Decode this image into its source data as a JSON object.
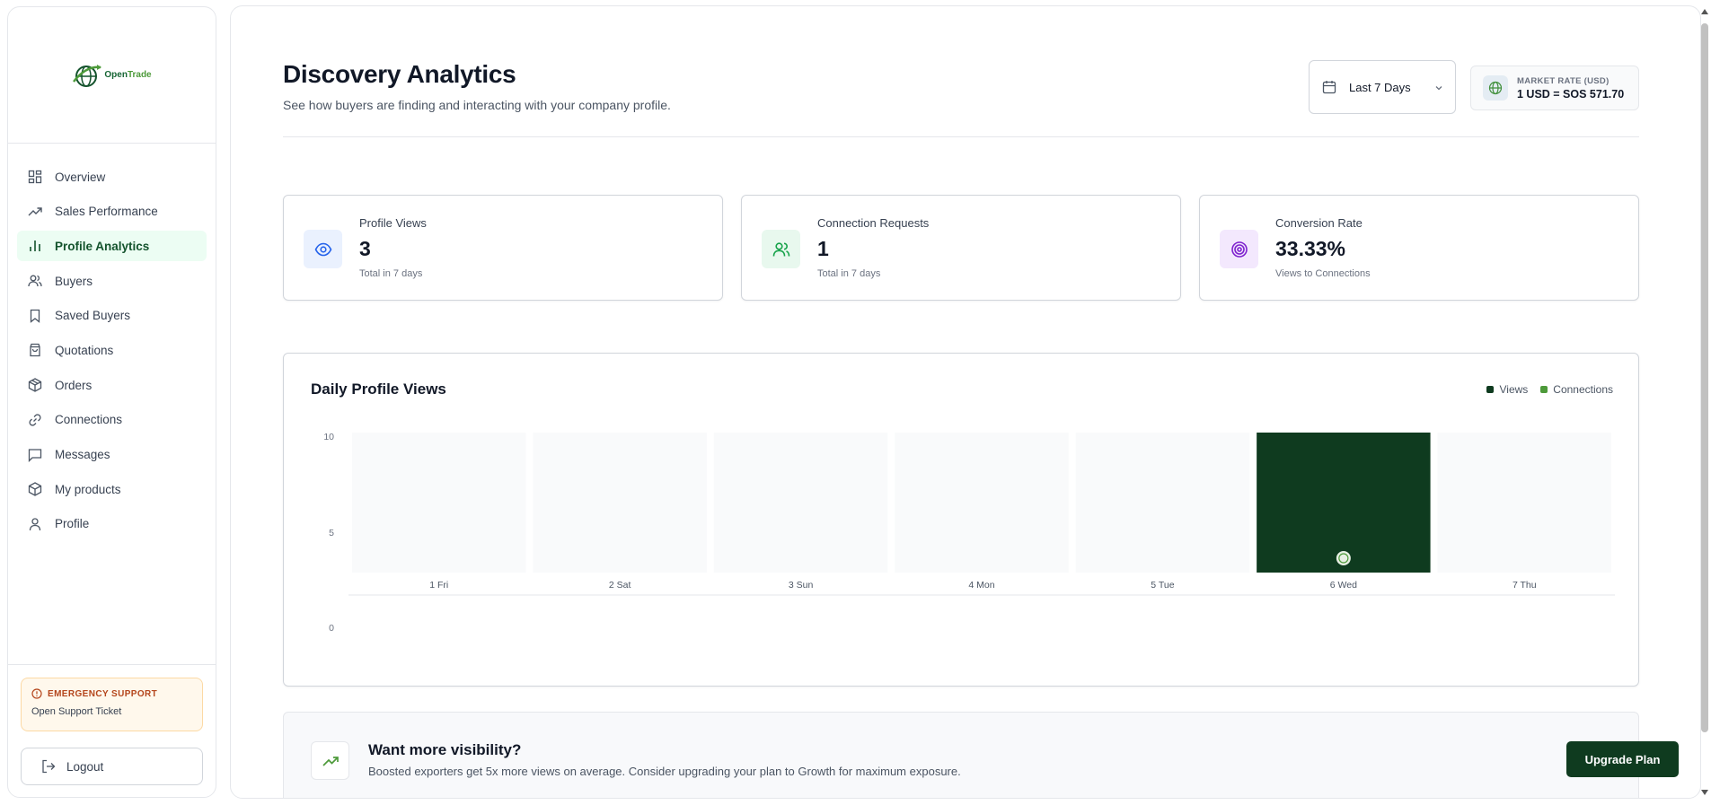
{
  "brand": {
    "name_prefix": "Open",
    "name_suffix": "Trade"
  },
  "sidebar": {
    "items": [
      {
        "label": "Overview",
        "icon": "layout-grid-icon"
      },
      {
        "label": "Sales Performance",
        "icon": "trending-up-icon"
      },
      {
        "label": "Profile Analytics",
        "icon": "bar-chart-icon",
        "active": true
      },
      {
        "label": "Buyers",
        "icon": "users-icon"
      },
      {
        "label": "Saved Buyers",
        "icon": "bookmark-icon"
      },
      {
        "label": "Quotations",
        "icon": "shopping-bag-icon"
      },
      {
        "label": "Orders",
        "icon": "package-icon"
      },
      {
        "label": "Connections",
        "icon": "link-icon"
      },
      {
        "label": "Messages",
        "icon": "message-square-icon"
      },
      {
        "label": "My products",
        "icon": "box-icon"
      },
      {
        "label": "Profile",
        "icon": "user-icon"
      }
    ],
    "emergency_title": "EMERGENCY SUPPORT",
    "emergency_link": "Open Support Ticket",
    "logout_label": "Logout"
  },
  "header": {
    "title": "Discovery Analytics",
    "subtitle": "See how buyers are finding and interacting with your company profile.",
    "date_range": "Last 7 Days",
    "market_label": "MARKET RATE (USD)",
    "market_value": "1 USD = SOS 571.70"
  },
  "stats": [
    {
      "title": "Profile Views",
      "value": "3",
      "sub": "Total in 7 days",
      "icon": "eye-icon",
      "color": "#2563eb",
      "bg": "#eaf1fe"
    },
    {
      "title": "Connection Requests",
      "value": "1",
      "sub": "Total in 7 days",
      "icon": "users-icon",
      "color": "#16a34a",
      "bg": "#e8f8ee"
    },
    {
      "title": "Conversion Rate",
      "value": "33.33%",
      "sub": "Views to Connections",
      "icon": "target-icon",
      "color": "#7e22ce",
      "bg": "#f3e8fd"
    }
  ],
  "chart_title": "Daily Profile Views",
  "chart_data": {
    "type": "bar",
    "categories": [
      "1 Fri",
      "2 Sat",
      "3 Sun",
      "4 Mon",
      "5 Tue",
      "6 Wed",
      "7 Thu"
    ],
    "series": [
      {
        "name": "Views",
        "values": [
          0,
          0,
          0,
          0,
          0,
          3,
          0
        ],
        "color": "#0f3b1f"
      },
      {
        "name": "Connections",
        "values": [
          0,
          0,
          0,
          0,
          0,
          1,
          0
        ],
        "color": "#4d9a3a"
      }
    ],
    "yticks": [
      "10",
      "5",
      "0"
    ],
    "ylim": [
      0,
      10
    ],
    "legend": "top-right",
    "highlight_category": "6 Wed"
  },
  "promo": {
    "title": "Want more visibility?",
    "description": "Boosted exporters get 5x more views on average. Consider upgrading your plan to Growth for maximum exposure.",
    "button": "Upgrade Plan"
  }
}
